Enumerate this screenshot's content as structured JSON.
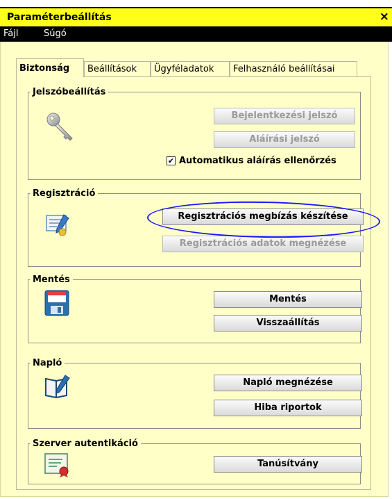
{
  "window": {
    "title": "Paraméterbeállítás",
    "close_label": "×"
  },
  "menu": {
    "items": [
      "Fájl",
      "Súgó"
    ]
  },
  "tabs": [
    "Biztonság",
    "Beállítások",
    "Ügyféladatok",
    "Felhasználó beállításai"
  ],
  "active_tab": "Biztonság",
  "groups": {
    "password": {
      "legend": "Jelszóbeállítás",
      "icon": "key-icon",
      "buttons": {
        "login_password": "Bejelentkezési jelszó",
        "signing_password": "Aláírási jelszó"
      },
      "checkbox": {
        "label": "Automatikus aláírás ellenőrzés",
        "checked": true,
        "mark": "✔"
      }
    },
    "registration": {
      "legend": "Regisztráció",
      "icon": "certificate-document-icon",
      "buttons": {
        "create_mandate": "Regisztrációs megbízás készítése",
        "view_data": "Regisztrációs adatok megnézése"
      }
    },
    "backup": {
      "legend": "Mentés",
      "icon": "floppy-disk-icon",
      "buttons": {
        "save": "Mentés",
        "restore": "Visszaállítás"
      }
    },
    "log": {
      "legend": "Napló",
      "icon": "log-book-icon",
      "buttons": {
        "view_log": "Napló megnézése",
        "error_reports": "Hiba riportok"
      }
    },
    "server_auth": {
      "legend": "Szerver autentikáció",
      "icon": "certificate-icon",
      "buttons": {
        "certificate": "Tanúsítvány"
      }
    }
  },
  "colors": {
    "title_bar": "#ffff1a",
    "menu_bar": "#000000",
    "window_bg": "#ffffc8",
    "annotation": "#1a1aff"
  }
}
